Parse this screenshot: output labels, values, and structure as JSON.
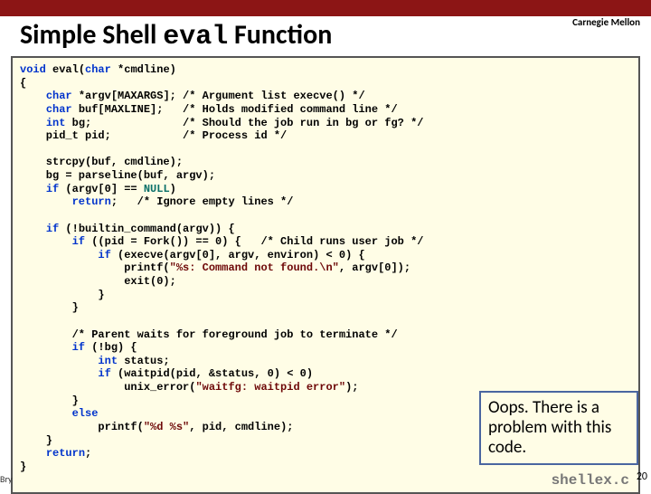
{
  "brand": "Carnegie Mellon",
  "title_pre": "Simple Shell ",
  "title_code": "eval",
  "title_post": " Function",
  "code": {
    "l1a": "void",
    "l1b": " eval(",
    "l1c": "char",
    "l1d": " *cmdline)",
    "l2": "{",
    "l3a": "    ",
    "l3b": "char",
    "l3c": " *argv[MAXARGS]; /* Argument list execve() */",
    "l4a": "    ",
    "l4b": "char",
    "l4c": " buf[MAXLINE];   /* Holds modified command line */",
    "l5a": "    ",
    "l5b": "int",
    "l5c": " bg;              /* Should the job run in bg or fg? */",
    "l6a": "    pid_t pid;           /* Process id */",
    "l7": "",
    "l8": "    strcpy(buf, cmdline);",
    "l9": "    bg = parseline(buf, argv);",
    "l10a": "    ",
    "l10b": "if",
    "l10c": " (argv[0] == ",
    "l10d": "NULL",
    "l10e": ")",
    "l11a": "        ",
    "l11b": "return",
    "l11c": ";   /* Ignore empty lines */",
    "l12": "",
    "l13a": "    ",
    "l13b": "if",
    "l13c": " (!builtin_command(argv)) {",
    "l14a": "        ",
    "l14b": "if",
    "l14c": " ((pid = Fork()) == 0) {   /* Child runs user job */",
    "l15a": "            ",
    "l15b": "if",
    "l15c": " (execve(argv[0], argv, environ) < 0) {",
    "l16a": "                printf(",
    "l16b": "\"%s: Command not found.\\n\"",
    "l16c": ", argv[0]);",
    "l17": "                exit(0);",
    "l18": "            }",
    "l19": "        }",
    "l20": "",
    "l21": "        /* Parent waits for foreground job to terminate */",
    "l22a": "        ",
    "l22b": "if",
    "l22c": " (!bg) {",
    "l23a": "            ",
    "l23b": "int",
    "l23c": " status;",
    "l24a": "            ",
    "l24b": "if",
    "l24c": " (waitpid(pid, &status, 0) < 0)",
    "l25a": "                unix_error(",
    "l25b": "\"waitfg: waitpid error\"",
    "l25c": ");",
    "l26": "        }",
    "l27a": "        ",
    "l27b": "else",
    "l28a": "            printf(",
    "l28b": "\"%d %s\"",
    "l28c": ", pid, cmdline);",
    "l29": "    }",
    "l30a": "    ",
    "l30b": "return",
    "l30c": ";",
    "l31": "}"
  },
  "filename": "shellex.c",
  "oops": "Oops.  There is a problem with this code.",
  "pagenum": "20",
  "attr": "Bry"
}
